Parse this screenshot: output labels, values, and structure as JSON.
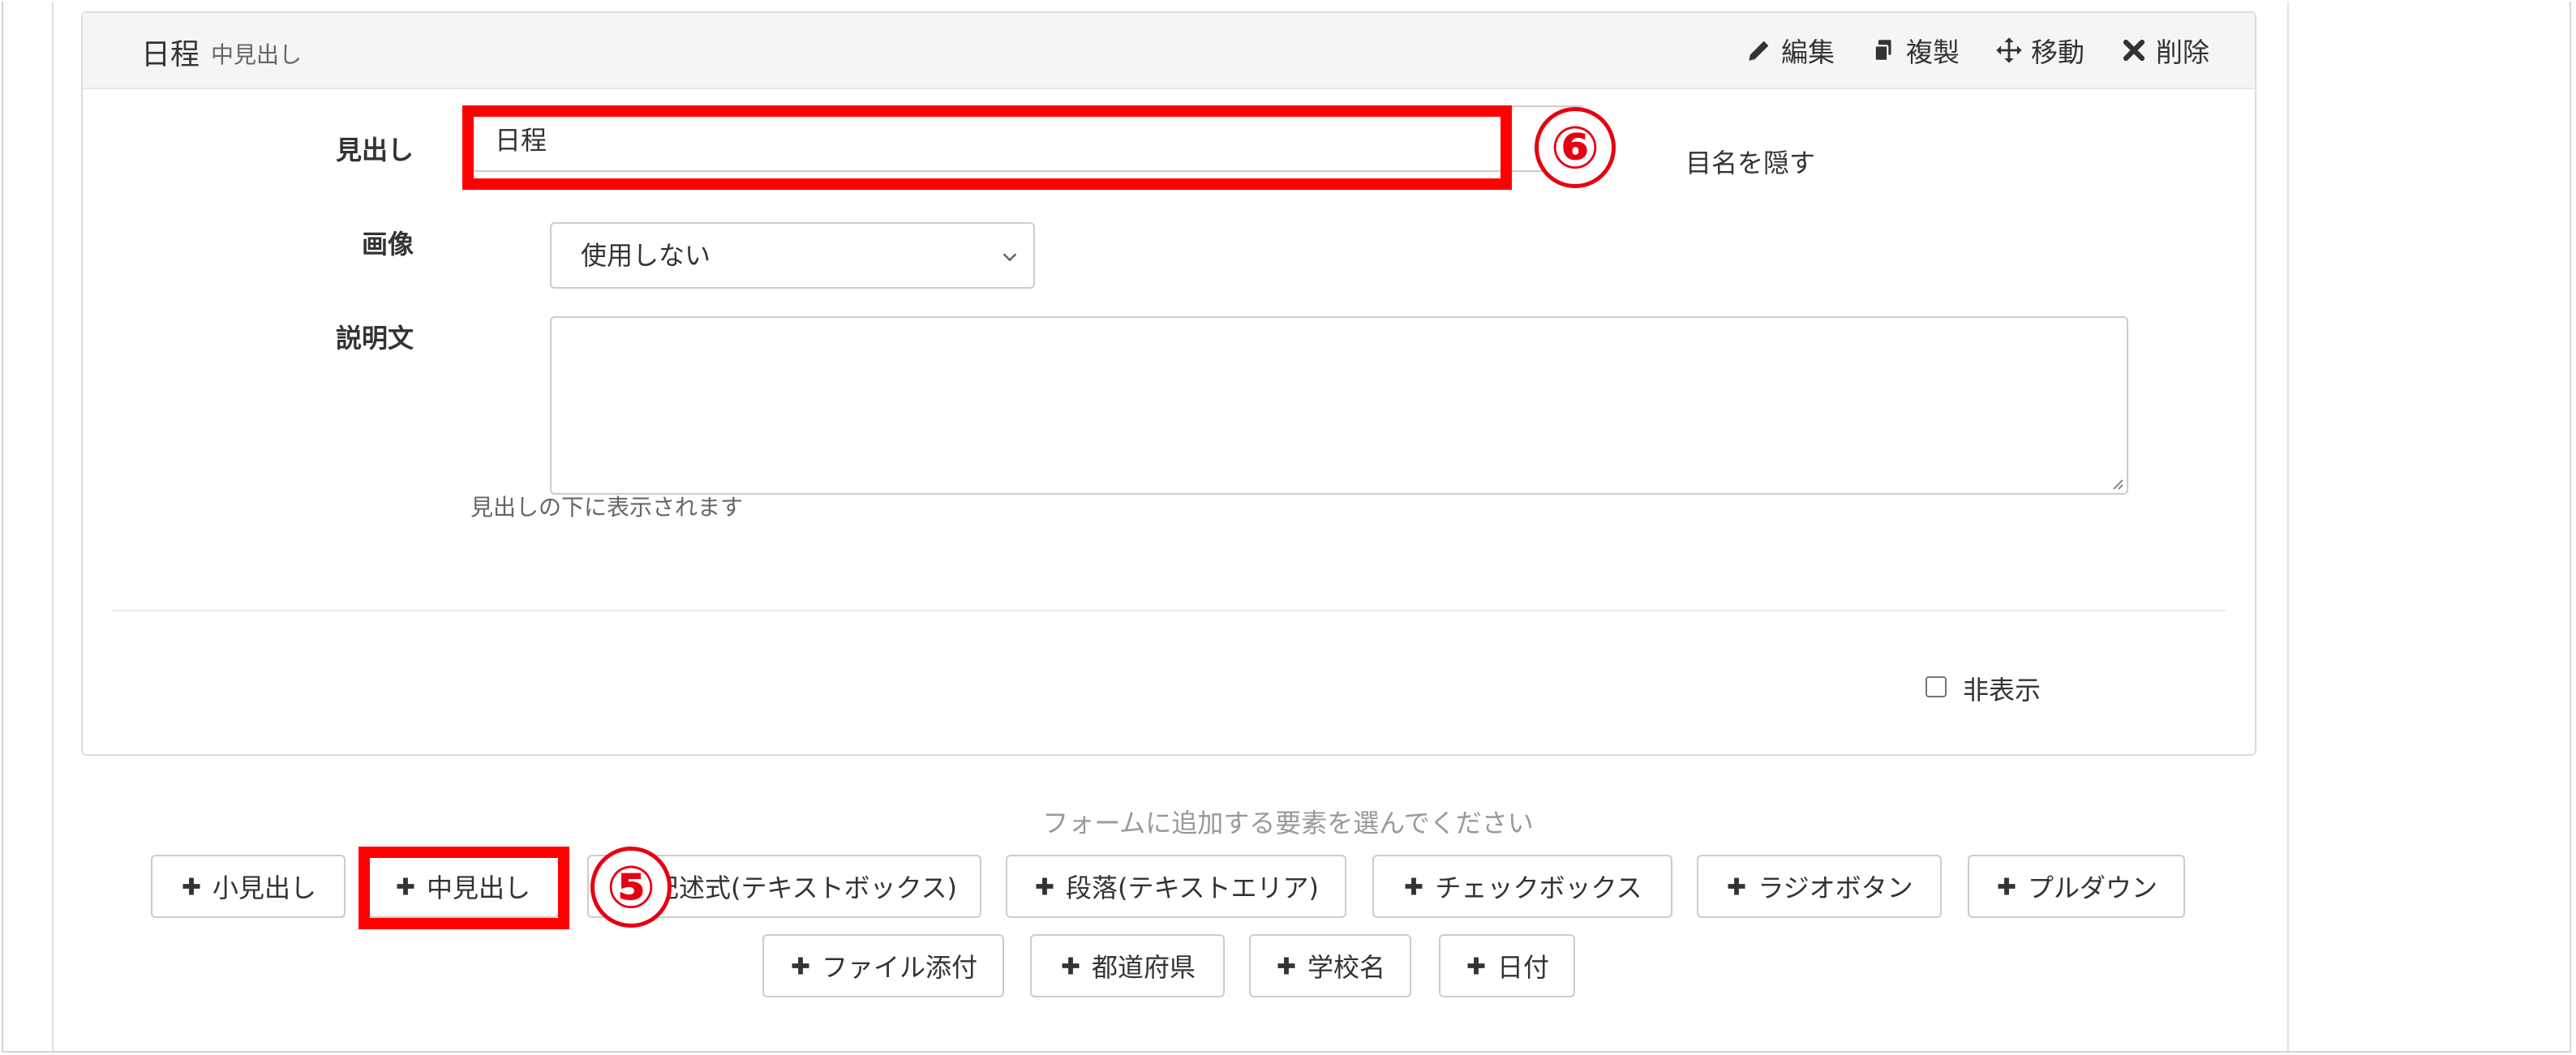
{
  "panel": {
    "title": "日程",
    "subtitle": "中見出し",
    "actions": [
      {
        "label": "編集",
        "icon": "pencil-icon"
      },
      {
        "label": "複製",
        "icon": "copy-icon"
      },
      {
        "label": "移動",
        "icon": "move-arrows-icon"
      },
      {
        "label": "削除",
        "icon": "close-x-icon"
      }
    ]
  },
  "form": {
    "heading_label": "見出し",
    "heading_value": "日程",
    "hide_item_name_label": "目名を隠す",
    "image_label": "画像",
    "image_selected": "使用しない",
    "description_label": "説明文",
    "description_value": "",
    "description_help": "見出しの下に表示されます",
    "hidden_label": "非表示"
  },
  "annotations": {
    "marker_6": "⑥",
    "marker_5": "⑤",
    "highlight_color": "#ff0000"
  },
  "add_elements": {
    "prompt": "フォームに追加する要素を選んでください",
    "buttons": [
      "小見出し",
      "中見出し",
      "記述式(テキストボックス)",
      "段落(テキストエリア)",
      "チェックボックス",
      "ラジオボタン",
      "プルダウン",
      "ファイル添付",
      "都道府県",
      "学校名",
      "日付"
    ]
  }
}
